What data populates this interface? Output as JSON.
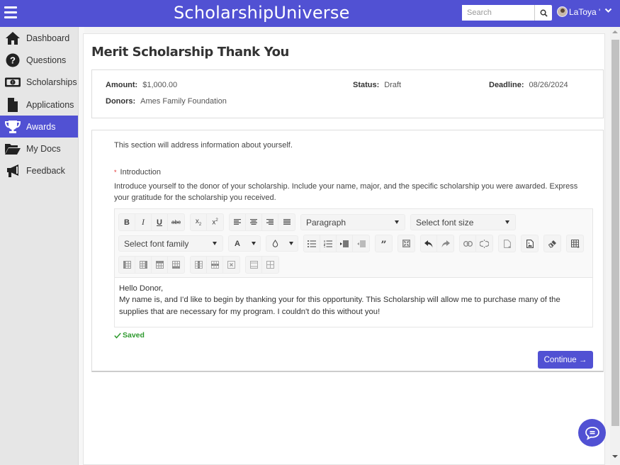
{
  "app": {
    "brand": "ScholarshipUniverse",
    "search_placeholder": "Search",
    "user_name": "LaToya '"
  },
  "sidebar": {
    "items": [
      {
        "label": "Dashboard",
        "icon": "home-icon",
        "active": false
      },
      {
        "label": "Questions",
        "icon": "question-circle-icon",
        "active": false
      },
      {
        "label": "Scholarships",
        "icon": "money-bill-icon",
        "active": false
      },
      {
        "label": "Applications",
        "icon": "file-icon",
        "active": false
      },
      {
        "label": "Awards",
        "icon": "trophy-icon",
        "active": true
      },
      {
        "label": "My Docs",
        "icon": "folder-open-icon",
        "active": false
      },
      {
        "label": "Feedback",
        "icon": "megaphone-icon",
        "active": false
      }
    ]
  },
  "page": {
    "title": "Merit Scholarship Thank You"
  },
  "info": {
    "amount_label": "Amount:",
    "amount_value": "$1,000.00",
    "donors_label": "Donors:",
    "donors_value": "Ames Family Foundation",
    "status_label": "Status:",
    "status_value": "Draft",
    "deadline_label": "Deadline:",
    "deadline_value": "08/26/2024"
  },
  "section": {
    "intro": "This section will address information about yourself.",
    "question_label": "Introduction",
    "question_required": "*",
    "question_description": "Introduce yourself to the donor of your scholarship. Include your name, major, and the specific scholarship you were awarded. Express your gratitude for the scholarship you received."
  },
  "editor": {
    "format_select": "Paragraph",
    "font_size_select": "Select font size",
    "font_family_select": "Select font family",
    "text_color_label": "A",
    "content_lines": [
      "Hello Donor,",
      "My name is, and I'd like to begin by thanking your for this opportunity. This Scholarship will allow me to purchase many of the supplies that are necessary for my program.  I couldn't do this without you!"
    ]
  },
  "status": {
    "saved": "Saved",
    "saved_color": "#2e9a2e"
  },
  "actions": {
    "continue": "Continue →"
  },
  "colors": {
    "brand": "#5151d3"
  }
}
